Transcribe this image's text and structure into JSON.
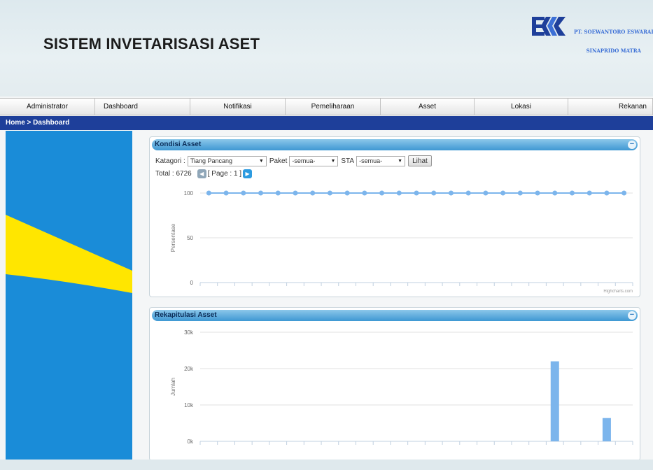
{
  "header": {
    "title": "SISTEM INVETARISASI ASET",
    "company_line1": "PT. SOEWANTORO ESWARAI",
    "company_line2": "SINAPRIDO MATRA",
    "brand_color": "#1e3f9a"
  },
  "nav": {
    "items": [
      {
        "label": "Administrator"
      },
      {
        "label": "Dashboard"
      },
      {
        "label": "Notifikasi"
      },
      {
        "label": "Pemeliharaan"
      },
      {
        "label": "Asset"
      },
      {
        "label": "Lokasi"
      },
      {
        "label": "Rekanan"
      }
    ]
  },
  "breadcrumb": "Home > Dashboard",
  "kondisi": {
    "title": "Kondisi Asset",
    "kategori_label": "Katagori :",
    "kategori_value": "Tiang Pancang",
    "paket_label": "Paket",
    "paket_value": "-semua-",
    "sta_label": "STA",
    "sta_value": "-semua-",
    "button_label": "Lihat",
    "total_label": "Total : 6726",
    "page_label": "[ Page : 1 ]",
    "credit": "Highcharts.com"
  },
  "rekap": {
    "title": "Rekapitulasi Asset"
  },
  "chart_data": [
    {
      "type": "line",
      "title": "Kondisi Asset",
      "ylabel": "Persentase",
      "yticks": [
        "0",
        "50",
        "100"
      ],
      "ylim": [
        0,
        100
      ],
      "n_points": 25,
      "series": [
        {
          "values": [
            100,
            100,
            100,
            100,
            100,
            100,
            100,
            100,
            100,
            100,
            100,
            100,
            100,
            100,
            100,
            100,
            100,
            100,
            100,
            100,
            100,
            100,
            100,
            100,
            100
          ]
        }
      ],
      "color": "#7cb5ec",
      "grid": true
    },
    {
      "type": "bar",
      "title": "Rekapitulasi Asset",
      "ylabel": "Jumlah",
      "yticks": [
        "0k",
        "10k",
        "20k",
        "30k"
      ],
      "ylim": [
        0,
        30000
      ],
      "n_categories": 25,
      "values": [
        0,
        0,
        0,
        0,
        0,
        0,
        0,
        0,
        0,
        0,
        0,
        0,
        0,
        0,
        0,
        0,
        0,
        0,
        0,
        0,
        22000,
        0,
        0,
        6400,
        0
      ],
      "color": "#7cb5ec",
      "grid": true
    }
  ]
}
